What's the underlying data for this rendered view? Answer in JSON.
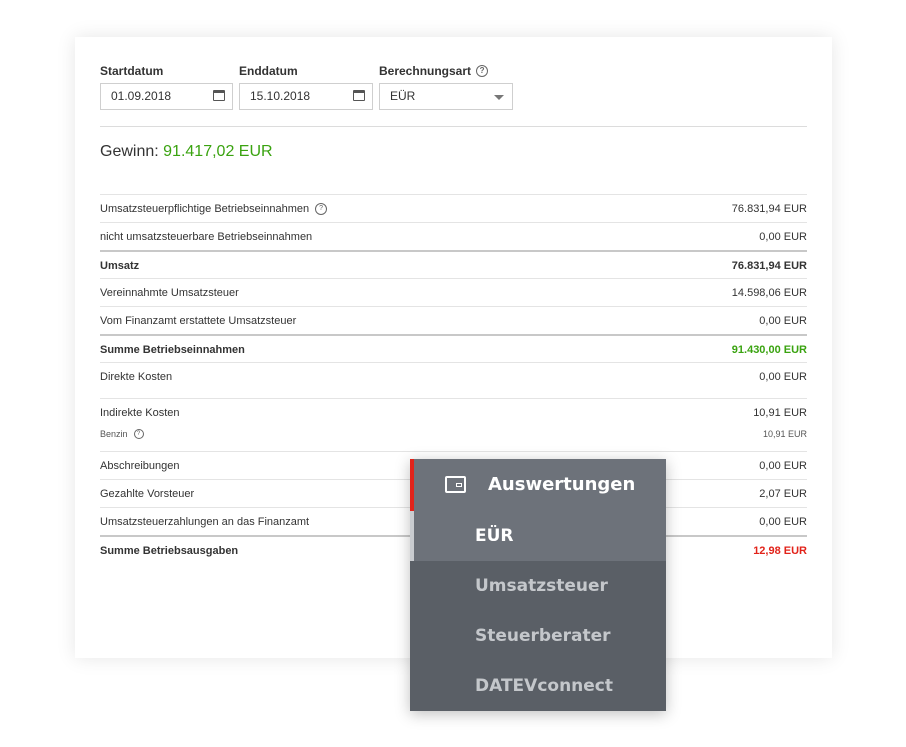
{
  "filters": {
    "start": {
      "label": "Startdatum",
      "value": "01.09.2018"
    },
    "end": {
      "label": "Enddatum",
      "value": "15.10.2018"
    },
    "method": {
      "label": "Berechnungsart",
      "value": "EÜR"
    }
  },
  "profit": {
    "label": "Gewinn:",
    "value": "91.417,02 EUR"
  },
  "rows": [
    {
      "label": "Umsatzsteuerpflichtige Betriebseinnahmen",
      "amount": "76.831,94 EUR"
    },
    {
      "label": "nicht umsatzsteuerbare Betriebseinnahmen",
      "amount": "0,00 EUR"
    },
    {
      "label": "Umsatz",
      "amount": "76.831,94 EUR"
    },
    {
      "label": "Vereinnahmte Umsatzsteuer",
      "amount": "14.598,06 EUR"
    },
    {
      "label": "Vom Finanzamt erstattete Umsatzsteuer",
      "amount": "0,00 EUR"
    },
    {
      "label": "Summe Betriebseinnahmen",
      "amount": "91.430,00 EUR"
    },
    {
      "label": "Direkte Kosten",
      "amount": "0,00 EUR"
    },
    {
      "label": "Indirekte Kosten",
      "amount": "10,91 EUR",
      "sub_label": "Benzin",
      "sub_amount": "10,91 EUR"
    },
    {
      "label": "Abschreibungen",
      "amount": "0,00 EUR"
    },
    {
      "label": "Gezahlte Vorsteuer",
      "amount": "2,07 EUR"
    },
    {
      "label": "Umsatzsteuerzahlungen an das Finanzamt",
      "amount": "0,00 EUR"
    },
    {
      "label": "Summe Betriebsausgaben",
      "amount": "12,98 EUR"
    }
  ],
  "menu": {
    "title": "Auswertungen",
    "items": [
      "EÜR",
      "Umsatzsteuer",
      "Steuerberater",
      "DATEVconnect"
    ]
  },
  "colors": {
    "positive": "#3aa310",
    "negative": "#e2231a",
    "menu_bg": "#5a5f66",
    "menu_active": "#6d727a"
  }
}
